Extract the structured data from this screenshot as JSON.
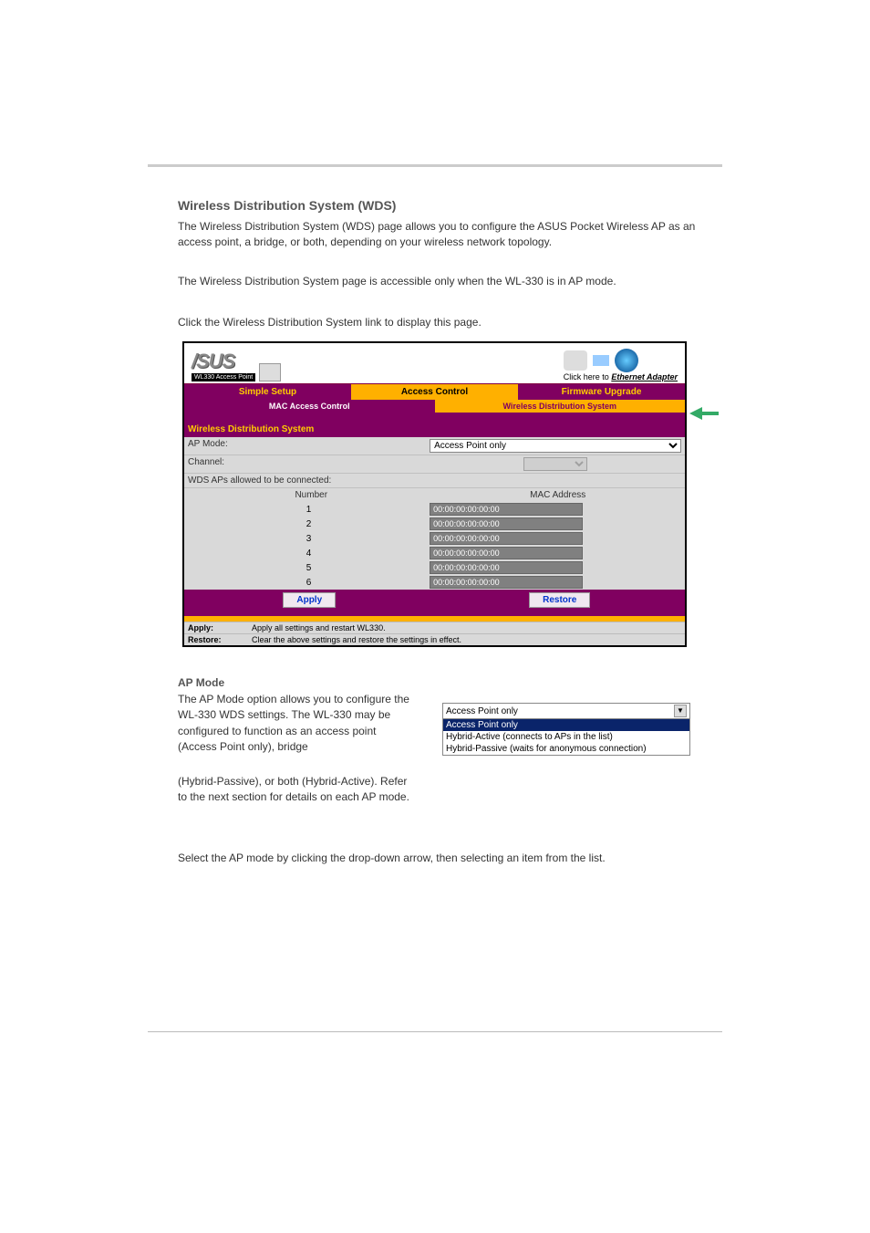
{
  "doc": {
    "sectionTitle": "Wireless Distribution System (WDS)",
    "p1": "The Wireless Distribution System (WDS) page allows you to configure the ASUS Pocket Wireless AP as an access point, a bridge, or both, depending on your wireless network topology.",
    "p2": "The Wireless Distribution System page is accessible only when the WL-330 is in AP mode.",
    "p3": "Click the Wireless Distribution System link to display this page.",
    "apModeTitle": "AP Mode",
    "p4": "The AP Mode option allows you to configure the WL-330 WDS settings. The WL-330 may be configured to function as an access point (Access Point only), bridge",
    "p5": "(Hybrid-Passive), or both (Hybrid-Active). Refer to the next section for details on each AP mode.",
    "p6": "Select the AP mode by clicking the drop-down arrow, then selecting an item from the list."
  },
  "ui": {
    "apLabel": "WL330 Access Point",
    "ethLinkPrefix": "Click here to ",
    "ethLinkBold": "Ethernet Adapter",
    "tabs": {
      "simple": "Simple Setup",
      "access": "Access Control",
      "firmware": "Firmware Upgrade"
    },
    "subtabs": {
      "mac": "MAC Access Control",
      "wds": "Wireless Distribution System"
    },
    "sectionHead": "Wireless Distribution System",
    "apModeLabel": "AP Mode:",
    "apModeValue": "Access Point only",
    "channelLabel": "Channel:",
    "channelValue": "",
    "listHead": "WDS APs allowed to be connected:",
    "colNum": "Number",
    "colMac": "MAC Address",
    "rows": [
      {
        "n": "1",
        "mac": "00:00:00:00:00:00"
      },
      {
        "n": "2",
        "mac": "00:00:00:00:00:00"
      },
      {
        "n": "3",
        "mac": "00:00:00:00:00:00"
      },
      {
        "n": "4",
        "mac": "00:00:00:00:00:00"
      },
      {
        "n": "5",
        "mac": "00:00:00:00:00:00"
      },
      {
        "n": "6",
        "mac": "00:00:00:00:00:00"
      }
    ],
    "applyBtn": "Apply",
    "restoreBtn": "Restore",
    "applyDescLabel": "Apply:",
    "applyDesc": "Apply all settings and restart WL330.",
    "restoreDescLabel": "Restore:",
    "restoreDesc": "Clear the above settings and restore the settings in effect."
  },
  "dropdown": {
    "selected": "Access Point only",
    "options": [
      "Access Point only",
      "Hybrid-Active (connects to APs in the list)",
      "Hybrid-Passive (waits for anonymous connection)"
    ]
  }
}
